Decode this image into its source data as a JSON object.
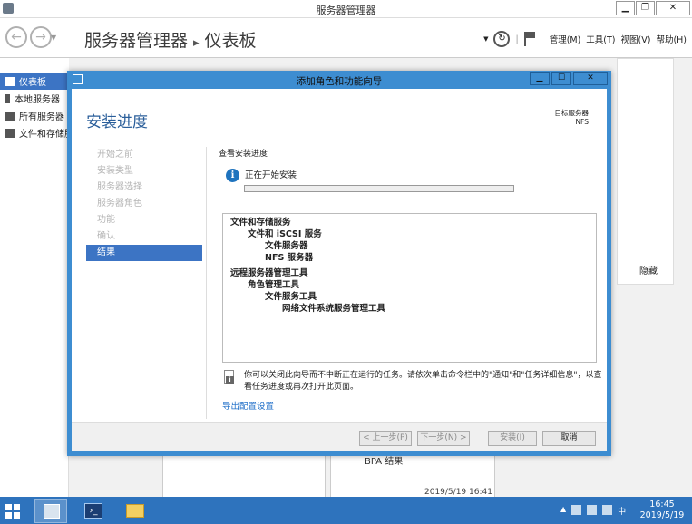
{
  "window": {
    "title": "服务器管理器",
    "controls": {
      "minimize": "▁",
      "restore": "❐",
      "close": "✕"
    }
  },
  "header": {
    "app_name": "服务器管理器",
    "page": "仪表板",
    "menus": [
      "管理(M)",
      "工具(T)",
      "视图(V)",
      "帮助(H)"
    ]
  },
  "sidebar": {
    "items": [
      {
        "label": "仪表板",
        "icon": "dashboard-icon",
        "active": true
      },
      {
        "label": "本地服务器",
        "icon": "server-icon",
        "active": false
      },
      {
        "label": "所有服务器",
        "icon": "servers-icon",
        "active": false
      },
      {
        "label": "文件和存储服务",
        "icon": "storage-icon",
        "active": false
      }
    ]
  },
  "background": {
    "hide_label": "隐藏",
    "bpa_label": "BPA 结果",
    "timestamp": "2019/5/19 16:41"
  },
  "wizard": {
    "title": "添加角色和功能向导",
    "heading": "安装进度",
    "target_label": "目标服务器",
    "target_value": "NFS",
    "steps": [
      {
        "label": "开始之前",
        "active": false
      },
      {
        "label": "安装类型",
        "active": false
      },
      {
        "label": "服务器选择",
        "active": false
      },
      {
        "label": "服务器角色",
        "active": false
      },
      {
        "label": "功能",
        "active": false
      },
      {
        "label": "确认",
        "active": false
      },
      {
        "label": "结果",
        "active": true
      }
    ],
    "section_title": "查看安装进度",
    "status": "正在开始安装",
    "progress": 0.0,
    "results": [
      {
        "text": "文件和存储服务",
        "level": 0
      },
      {
        "text": "文件和 iSCSI 服务",
        "level": 1
      },
      {
        "text": "文件服务器",
        "level": 2
      },
      {
        "text": "NFS 服务器",
        "level": 2
      },
      {
        "text": "",
        "level": -1
      },
      {
        "text": "远程服务器管理工具",
        "level": 0
      },
      {
        "text": "角色管理工具",
        "level": 1
      },
      {
        "text": "文件服务工具",
        "level": 2
      },
      {
        "text": "网络文件系统服务管理工具",
        "level": 3
      }
    ],
    "note": "你可以关闭此向导而不中断正在运行的任务。请依次单击命令栏中的\"通知\"和\"任务详细信息\"，以查看任务进度或再次打开此页面。",
    "export_link": "导出配置设置",
    "buttons": {
      "prev": "< 上一步(P)",
      "next": "下一步(N) >",
      "install": "安装(I)",
      "cancel": "取消"
    }
  },
  "taskbar": {
    "time": "16:45",
    "date": "2019/5/19",
    "ime": "中"
  },
  "colors": {
    "accent": "#3c74c4",
    "dialog_border": "#3d8dd1",
    "taskbar": "#2e73bd",
    "link": "#1e6ec8"
  }
}
